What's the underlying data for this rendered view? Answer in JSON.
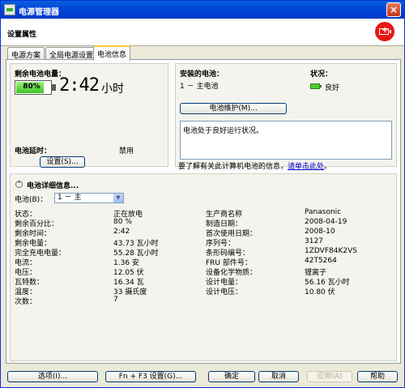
{
  "window": {
    "title": "电源管理器",
    "close": "×"
  },
  "header": {
    "title": "设置属性"
  },
  "tabs": [
    {
      "label": "电源方案"
    },
    {
      "label": "全局电源设置"
    },
    {
      "label": "电池信息"
    }
  ],
  "battery_status": {
    "remaining_label": "剩余电池电量：",
    "percent_text": "80%",
    "percent_value": 80,
    "time": "2:42",
    "time_unit": "小时",
    "delay_label": "电池延时：",
    "delay_value": "禁用",
    "settings_button": "设置(S)..."
  },
  "installed": {
    "label": "安装的电池：",
    "status_label": "状况：",
    "battery_name": "1 － 主电池",
    "status_value": "良好",
    "maintenance_button": "电池维护(M)...",
    "status_message": "电池处于良好运行状况。",
    "more_info_text": "要了解有关此计算机电池的信息，",
    "more_info_link": "请单击此处",
    "more_info_end": "。"
  },
  "details": {
    "heading": "电池详细信息...",
    "battery_select_label": "电池(B)：",
    "battery_select_value": "1 － 主",
    "left": [
      {
        "label": "状态：",
        "value": "正在放电"
      },
      {
        "label": "剩余百分比：",
        "value": "80 %"
      },
      {
        "label": "剩余时间：",
        "value": "2:42"
      },
      {
        "label": "剩余电量：",
        "value": "43.73 瓦小时"
      },
      {
        "label": "完全充电电量：",
        "value": "55.28 瓦小时"
      },
      {
        "label": "电流：",
        "value": "1.36 安"
      },
      {
        "label": "电压：",
        "value": "12.05 伏"
      },
      {
        "label": "瓦特数：",
        "value": "16.34 瓦"
      },
      {
        "label": "温度：",
        "value": "33 摄氏度"
      },
      {
        "label": "次数：",
        "value": "7"
      }
    ],
    "right": [
      {
        "label": "生产商名称",
        "value": "Panasonic"
      },
      {
        "label": "制造日期：",
        "value": "2008-04-19"
      },
      {
        "label": "首次使用日期：",
        "value": "2008-10"
      },
      {
        "label": "序列号：",
        "value": "3127"
      },
      {
        "label": "条形码编号：",
        "value": "1ZDVF84K2VS"
      },
      {
        "label": "FRU 部件号：",
        "value": "42T5264"
      },
      {
        "label": "设备化学物质：",
        "value": "锂离子"
      },
      {
        "label": "设计电量：",
        "value": "56.16 瓦小时"
      },
      {
        "label": "设计电压：",
        "value": "10.80 伏"
      }
    ]
  },
  "footer": {
    "options": "选项(I)...",
    "fn_f3": "Fn + F3 设置(G)...",
    "ok": "确定",
    "cancel": "取消",
    "apply": "应用(A)",
    "help": "帮助"
  }
}
